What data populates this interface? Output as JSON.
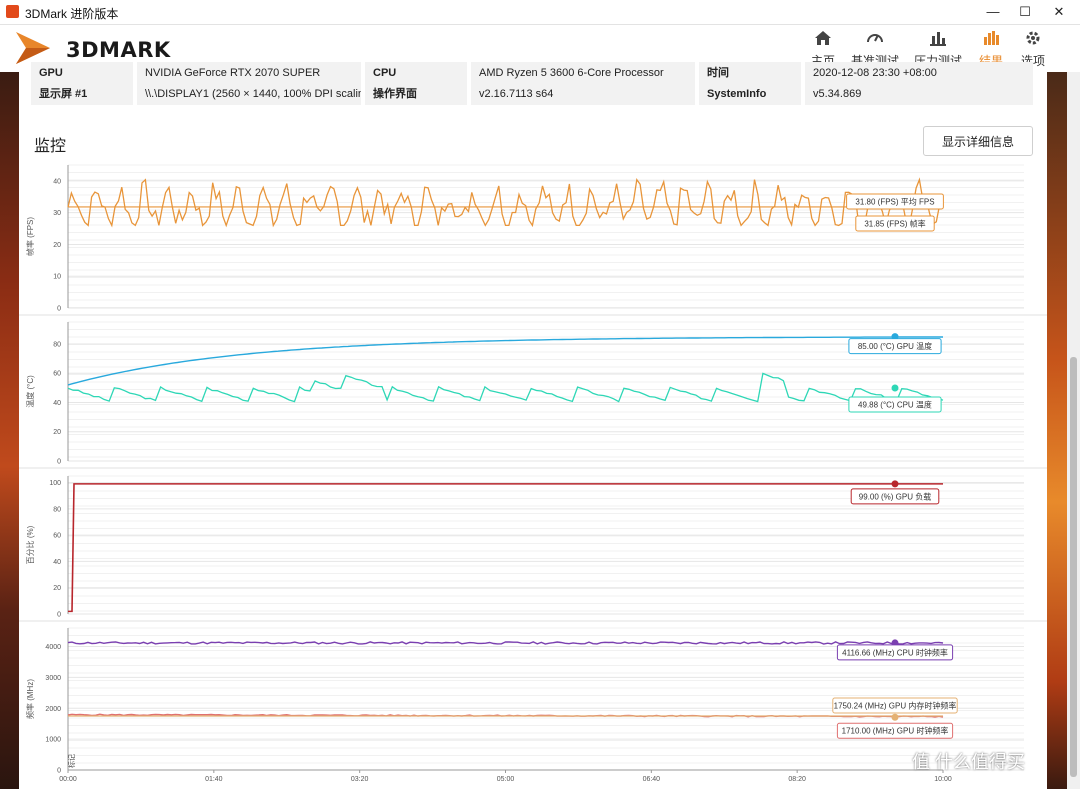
{
  "window": {
    "title": "3DMark 进阶版本",
    "minimize": "—",
    "maximize": "☐",
    "close": "✕"
  },
  "brand": {
    "name": "3DMARK"
  },
  "nav": [
    {
      "label": "主页",
      "icon": "home-icon",
      "active": false
    },
    {
      "label": "基准测试",
      "icon": "gauge-icon",
      "active": false
    },
    {
      "label": "压力测试",
      "icon": "bars-icon",
      "active": false
    },
    {
      "label": "结果",
      "icon": "results-icon",
      "active": true
    },
    {
      "label": "选项",
      "icon": "gear-icon",
      "active": false
    }
  ],
  "info": {
    "row1": [
      {
        "label": "GPU",
        "value": "NVIDIA GeForce RTX 2070 SUPER"
      },
      {
        "label": "CPU",
        "value": "AMD Ryzen 5 3600 6-Core Processor"
      },
      {
        "label": "时间",
        "value": "2020-12-08 23:30 +08:00"
      }
    ],
    "row2": [
      {
        "label": "显示屏 #1",
        "value": "\\\\.\\DISPLAY1 (2560 × 1440, 100% DPI scaling)"
      },
      {
        "label": "操作界面",
        "value": "v2.16.7113 s64"
      },
      {
        "label": "SystemInfo",
        "value": "v5.34.869"
      }
    ]
  },
  "monitor": {
    "title": "监控",
    "detail_button": "显示详细信息"
  },
  "colors": {
    "fps": "#e8953a",
    "gpu_temp": "#29a9dd",
    "cpu_temp": "#2ed7b6",
    "gpu_load": "#b8262c",
    "cpu_clock": "#7a3fb0",
    "gpu_mem_clock": "#e4b173",
    "gpu_clock": "#e07070",
    "accent": "#e88a2b"
  },
  "chart_data": [
    {
      "type": "line",
      "ylabel": "帧率 (FPS)",
      "ylim": [
        0,
        45
      ],
      "yticks": [
        "0",
        "10",
        "20",
        "30",
        "40"
      ],
      "series": [
        {
          "name": "帧率",
          "summary": "31.85 (FPS) 帧率",
          "pattern": "oscillating 27–42"
        },
        {
          "name": "平均 FPS",
          "summary": "31.80 (FPS) 平均 FPS",
          "values": [
            31.8
          ]
        }
      ]
    },
    {
      "type": "line",
      "ylabel": "温度 (°C)",
      "ylim": [
        0,
        95
      ],
      "yticks": [
        "0",
        "20",
        "40",
        "60",
        "80"
      ],
      "series": [
        {
          "name": "GPU 温度",
          "summary": "85.00 (°C) GPU 温度",
          "start": 52,
          "end": 85
        },
        {
          "name": "CPU 温度",
          "summary": "49.88 (°C) CPU 温度",
          "baseline": 40,
          "peaks": [
            50,
            60
          ]
        }
      ]
    },
    {
      "type": "line",
      "ylabel": "百分比 (%)",
      "ylim": [
        0,
        105
      ],
      "yticks": [
        "0",
        "20",
        "40",
        "60",
        "80",
        "100"
      ],
      "series": [
        {
          "name": "GPU 负载",
          "summary": "99.00 (%) GPU 负载",
          "start": 2,
          "end": 99
        }
      ]
    },
    {
      "type": "line",
      "ylabel": "频率 (MHz)",
      "ylim": [
        0,
        4600
      ],
      "yticks": [
        "0",
        "1000",
        "2000",
        "3000",
        "4000"
      ],
      "series": [
        {
          "name": "CPU 时钟频率",
          "summary": "4116.66 (MHz) CPU 时钟频率",
          "values": [
            4116.66
          ]
        },
        {
          "name": "GPU 内存时钟频率",
          "summary": "1750.24 (MHz) GPU 内存时钟频率",
          "values": [
            1750.24
          ]
        },
        {
          "name": "GPU 时钟频率",
          "summary": "1710.00 (MHz) GPU 时钟频率",
          "values": [
            1710.0
          ]
        }
      ],
      "marker_label": "标记"
    }
  ],
  "xaxis": {
    "ticks": [
      "00:00",
      "01:40",
      "03:20",
      "05:00",
      "06:40",
      "08:20",
      "10:00"
    ]
  },
  "watermark": "值 什么值得买"
}
